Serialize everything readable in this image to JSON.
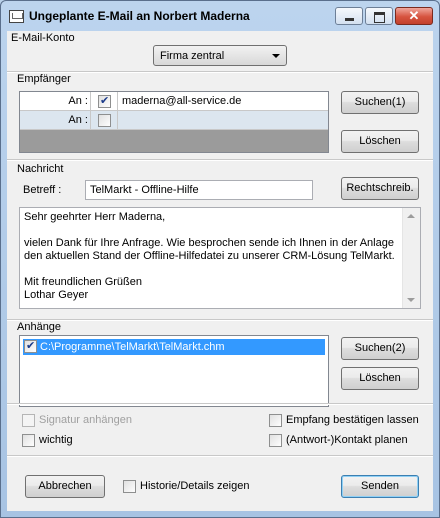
{
  "window": {
    "title": "Ungeplante E-Mail an Norbert Maderna",
    "controls": {
      "minimize": "minimize",
      "maximize": "maximize",
      "close": "✕"
    }
  },
  "account": {
    "section_label": "E-Mail-Konto",
    "selected": "Firma zentral"
  },
  "recipients": {
    "section_label": "Empfänger",
    "rows": [
      {
        "label": "An :",
        "checked": true,
        "value": "maderna@all-service.de"
      },
      {
        "label": "An :",
        "checked": false,
        "value": ""
      }
    ],
    "search_button": "Suchen(1)",
    "delete_button": "Löschen"
  },
  "message": {
    "section_label": "Nachricht",
    "subject_label": "Betreff :",
    "subject_value": "TelMarkt - Offline-Hilfe",
    "spellcheck_button": "Rechtschreib.",
    "body": "Sehr geehrter Herr Maderna,\n\nvielen Dank für Ihre Anfrage. Wie besprochen sende ich Ihnen in der Anlage\nden aktuellen Stand der Offline-Hilfedatei zu unserer CRM-Lösung TelMarkt.\n\nMit freundlichen Grüßen\nLothar Geyer"
  },
  "attachments": {
    "section_label": "Anhänge",
    "items": [
      {
        "checked": true,
        "path": "C:\\Programme\\TelMarkt\\TelMarkt.chm"
      }
    ],
    "search_button": "Suchen(2)",
    "delete_button": "Löschen"
  },
  "options": {
    "signature": {
      "label": "Signatur anhängen",
      "checked": false,
      "enabled": false
    },
    "important": {
      "label": "wichtig",
      "checked": false
    },
    "confirm_receipt": {
      "label": "Empfang bestätigen lassen",
      "checked": false
    },
    "plan_contact": {
      "label": "(Antwort-)Kontakt planen",
      "checked": false
    }
  },
  "footer": {
    "cancel_button": "Abbrechen",
    "history_label": "Historie/Details zeigen",
    "history_checked": false,
    "send_button": "Senden"
  }
}
